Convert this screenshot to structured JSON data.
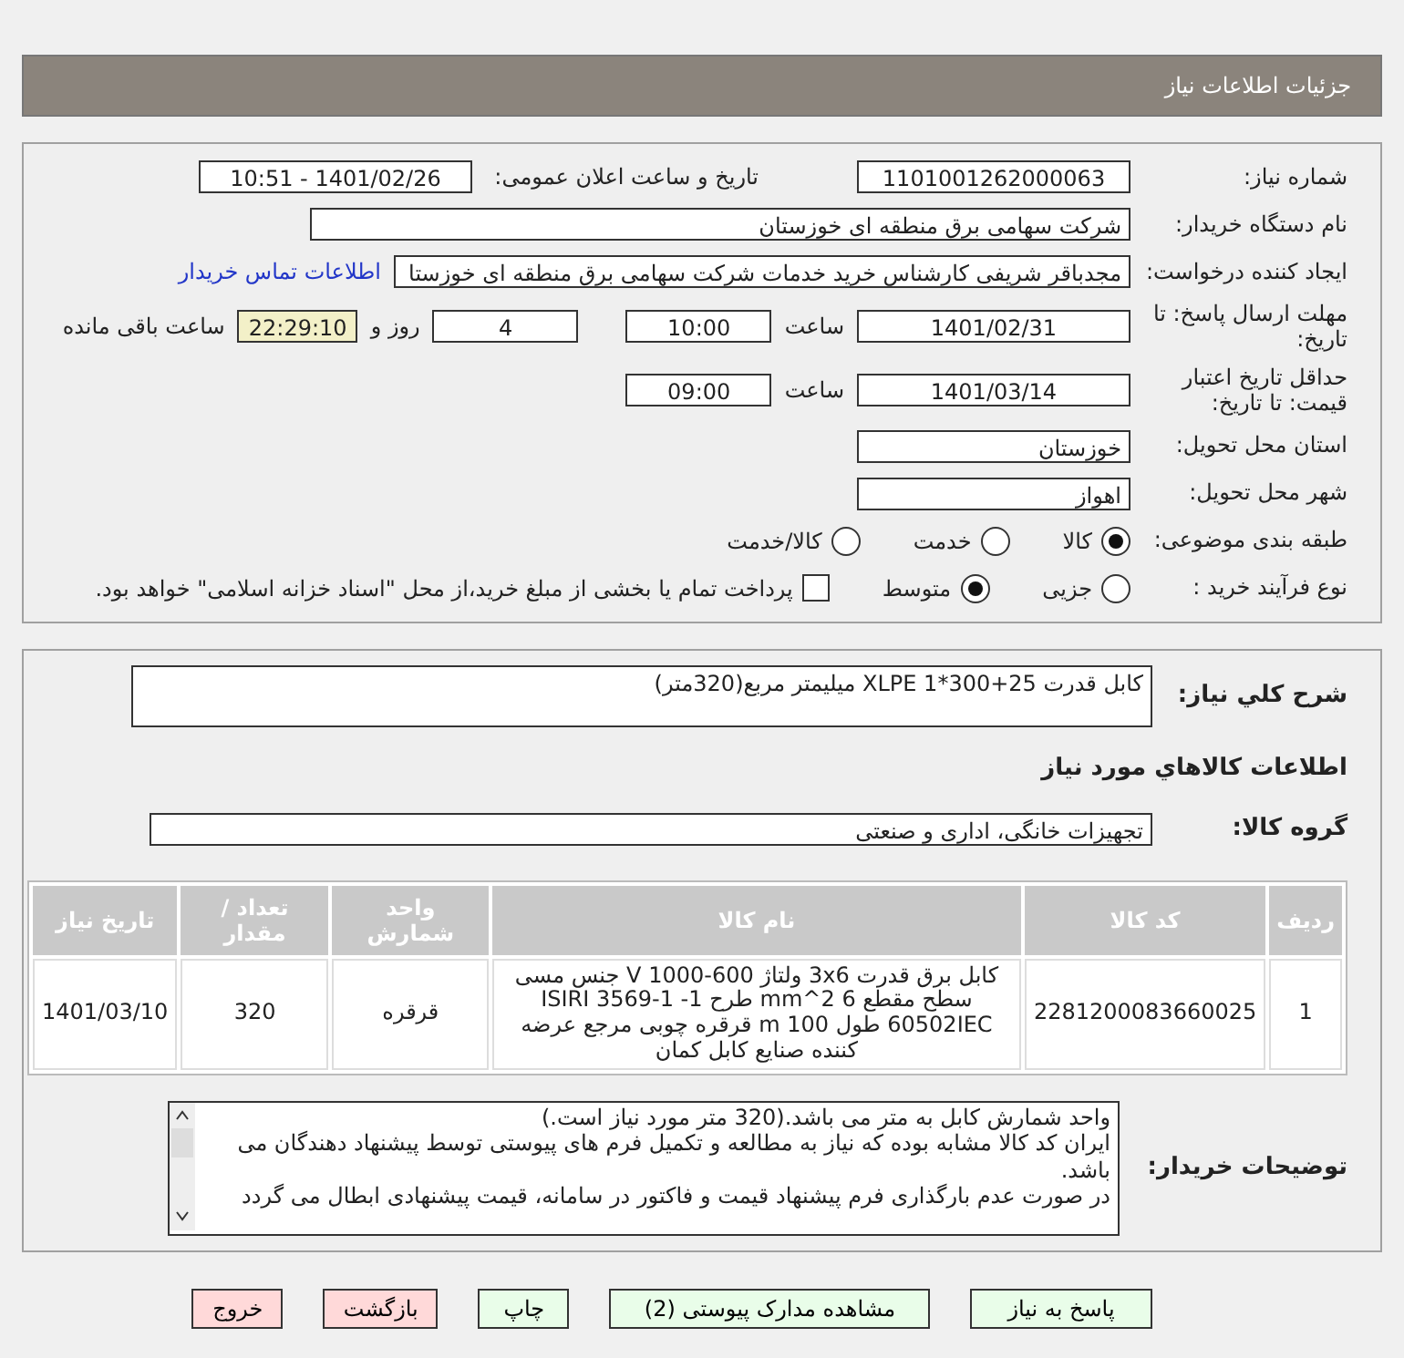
{
  "header": {
    "title": "جزئیات اطلاعات نیاز"
  },
  "details": {
    "need_number": {
      "label": "شماره نیاز:",
      "value": "1101001262000063"
    },
    "announce": {
      "label": "تاریخ و ساعت اعلان عمومی:",
      "value": "1401/02/26 - 10:51"
    },
    "buyer": {
      "label": "نام دستگاه خریدار:",
      "value": "شرکت سهامی برق منطقه ای خوزستان"
    },
    "requester": {
      "label": "ایجاد کننده درخواست:",
      "value": "مجدباقر شریفی کارشناس خرید خدمات شرکت سهامی برق منطقه ای خوزستا",
      "link": "اطلاعات تماس خریدار"
    },
    "deadline": {
      "label": "مهلت ارسال پاسخ: تا تاریخ:",
      "date": "1401/02/31",
      "time_label": "ساعت",
      "time": "10:00",
      "days": "4",
      "days_label": "روز و",
      "remaining": "22:29:10",
      "remaining_label": "ساعت باقی مانده"
    },
    "validity": {
      "label": "حداقل تاریخ اعتبار قیمت: تا تاریخ:",
      "date": "1401/03/14",
      "time_label": "ساعت",
      "time": "09:00"
    },
    "province": {
      "label": "استان محل تحویل:",
      "value": "خوزستان"
    },
    "city": {
      "label": "شهر محل تحویل:",
      "value": "اهواز"
    },
    "category": {
      "label": "طبقه بندی موضوعی:",
      "options": [
        {
          "label": "کالا",
          "selected": true
        },
        {
          "label": "خدمت",
          "selected": false
        },
        {
          "label": "کالا/خدمت",
          "selected": false
        }
      ]
    },
    "process": {
      "label": "نوع فرآیند خرید :",
      "options": [
        {
          "label": "جزیی",
          "selected": false
        },
        {
          "label": "متوسط",
          "selected": true
        }
      ],
      "payment": {
        "label": "پرداخت تمام یا بخشی از مبلغ خرید،از محل \"اسناد خزانه اسلامی\" خواهد بود.",
        "checked": false
      }
    }
  },
  "goods": {
    "summary": {
      "label": "شرح کلي نياز:",
      "value": "کابل قدرت 25+300*1 XLPE ميليمتر مربع(320متر)"
    },
    "section_title": "اطلاعات کالاهاي مورد نياز",
    "group": {
      "label": "گروه کالا:",
      "value": "تجهیزات خانگی، اداری و صنعتی"
    },
    "table": {
      "columns": [
        "ردیف",
        "کد کالا",
        "نام کالا",
        "واحد شمارش",
        "تعداد / مقدار",
        "تاریخ نیاز"
      ],
      "rows": [
        [
          "1",
          "2281200083660025",
          "کابل برق قدرت 3x6 ولتاژ 600-1000 V جنس مسی سطح مقطع 6 mm^2 طرح ISIRI 3569-1 -1 60502IEC طول 100 m قرقره چوبی مرجع عرضه کننده صنایع کابل کمان",
          "قرقره",
          "320",
          "1401/03/10"
        ]
      ]
    },
    "notes": {
      "label": "توضیحات خریدار:",
      "lines": [
        "واحد شمارش کابل به متر می باشد.(320 متر مورد نیاز است.)",
        "ایران کد کالا مشابه بوده که نیاز به مطالعه و تکمیل فرم های پیوستی توسط پیشنهاد دهندگان می باشد.",
        "در صورت عدم بارگذاری فرم پیشنهاد قیمت و فاکتور در سامانه، قیمت پیشنهادی ابطال می گردد"
      ]
    }
  },
  "buttons": [
    {
      "label": "پاسخ به نیاز",
      "kind": "action"
    },
    {
      "label": "مشاهده مدارک پیوستی (2)",
      "kind": "action"
    },
    {
      "label": "چاپ",
      "kind": "action"
    },
    {
      "label": "بازگشت",
      "kind": "exit"
    },
    {
      "label": "خروج",
      "kind": "exit"
    }
  ]
}
